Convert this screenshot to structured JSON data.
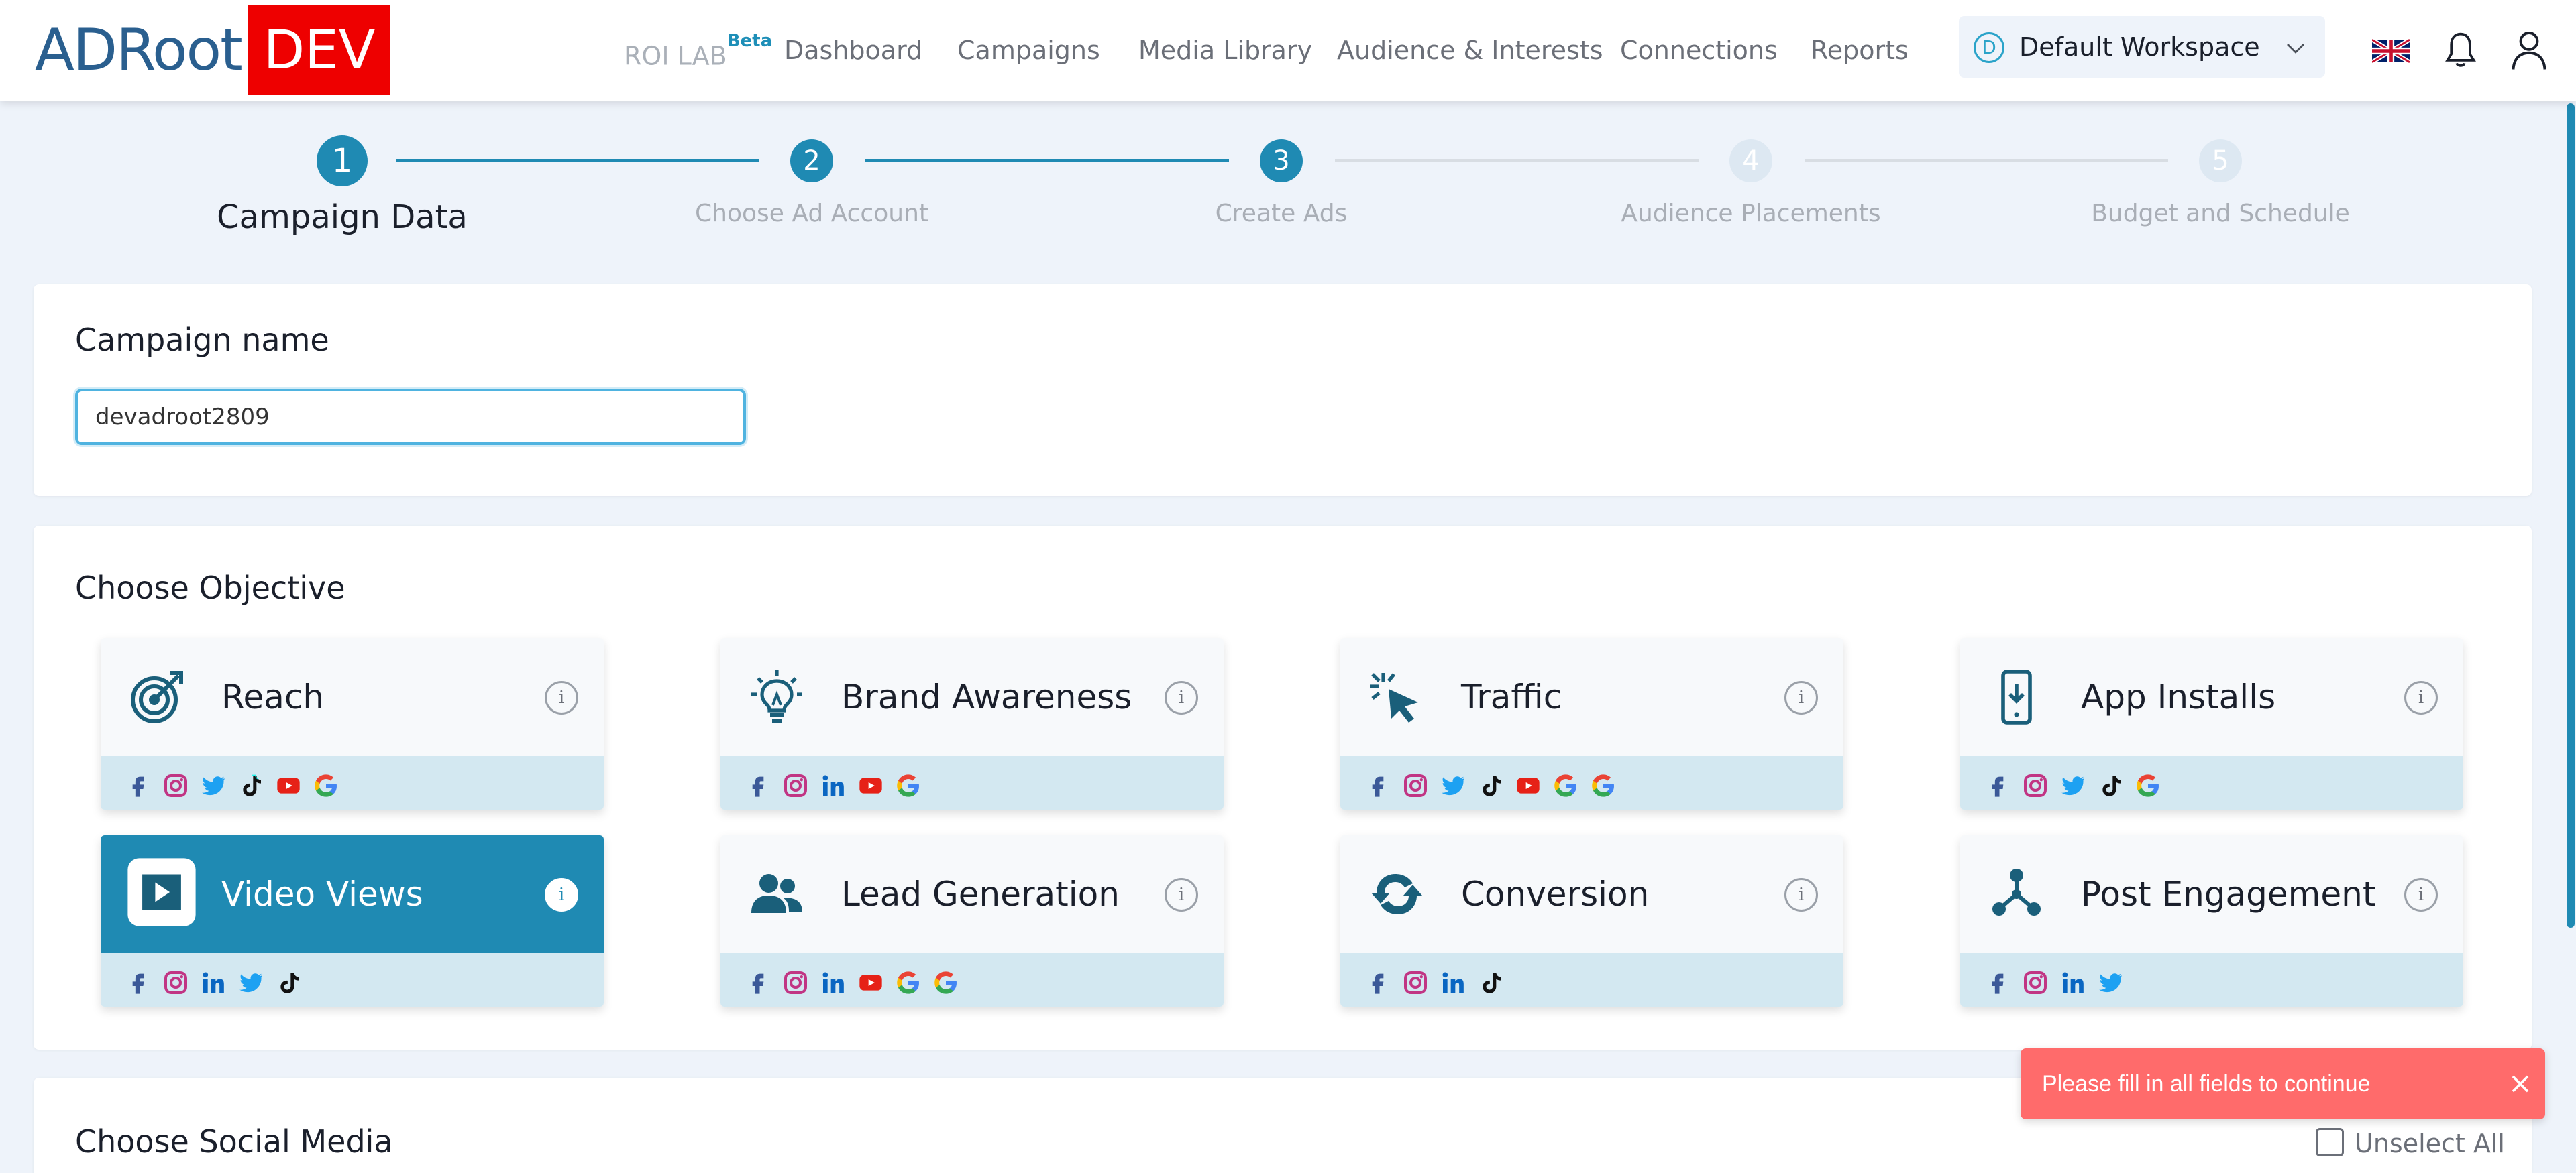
{
  "header": {
    "logo_text": "ADRoot",
    "env_badge": "DEV",
    "nav": {
      "roi_lab": "ROI LAB",
      "roi_beta": "Beta",
      "dashboard": "Dashboard",
      "campaigns": "Campaigns",
      "media_library": "Media Library",
      "audience": "Audience & Interests",
      "connections": "Connections",
      "reports": "Reports"
    },
    "workspace": {
      "initial": "D",
      "label": "Default Workspace"
    },
    "icons": [
      "uk-flag-icon",
      "bell-icon",
      "user-icon"
    ]
  },
  "stepper": {
    "current_step": 1,
    "steps": [
      {
        "number": "1",
        "label": "Campaign Data",
        "state": "active"
      },
      {
        "number": "2",
        "label": "Choose Ad Account",
        "state": "done"
      },
      {
        "number": "3",
        "label": "Create Ads",
        "state": "done"
      },
      {
        "number": "4",
        "label": "Audience Placements",
        "state": "pending"
      },
      {
        "number": "5",
        "label": "Budget and Schedule",
        "state": "pending"
      }
    ]
  },
  "campaign_name": {
    "title": "Campaign name",
    "value": "devadroot2809"
  },
  "objective": {
    "title": "Choose Objective",
    "info_glyph": "i",
    "selected": "Video Views",
    "items": [
      {
        "label": "Reach",
        "icon": "target-icon",
        "platforms": [
          "facebook",
          "instagram",
          "twitter",
          "tiktok",
          "youtube",
          "google"
        ]
      },
      {
        "label": "Brand Awareness",
        "icon": "lightbulb-icon",
        "platforms": [
          "facebook",
          "instagram",
          "linkedin",
          "youtube",
          "google"
        ]
      },
      {
        "label": "Traffic",
        "icon": "cursor-click-icon",
        "platforms": [
          "facebook",
          "instagram",
          "twitter",
          "tiktok",
          "youtube",
          "google",
          "google"
        ]
      },
      {
        "label": "App Installs",
        "icon": "phone-download-icon",
        "platforms": [
          "facebook",
          "instagram",
          "twitter",
          "tiktok",
          "google"
        ]
      },
      {
        "label": "Video Views",
        "icon": "play-icon",
        "platforms": [
          "facebook",
          "instagram",
          "linkedin",
          "twitter",
          "tiktok"
        ]
      },
      {
        "label": "Lead Generation",
        "icon": "users-icon",
        "platforms": [
          "facebook",
          "instagram",
          "linkedin",
          "youtube",
          "google",
          "google"
        ]
      },
      {
        "label": "Conversion",
        "icon": "sync-icon",
        "platforms": [
          "facebook",
          "instagram",
          "linkedin",
          "tiktok"
        ]
      },
      {
        "label": "Post Engagement",
        "icon": "network-icon",
        "platforms": [
          "facebook",
          "instagram",
          "linkedin",
          "twitter"
        ]
      }
    ]
  },
  "social_media": {
    "title": "Choose Social Media",
    "unselect_all": "Unselect All",
    "unselect_checked": false
  },
  "toast": {
    "message": "Please fill in all fields to continue",
    "type": "error"
  },
  "colors": {
    "accent": "#1f8ab3",
    "dev_badge": "#ee0000",
    "toast_bg": "#ff6b6b",
    "platform_strip": "#d3e8f1",
    "page_bg": "#eef3fa"
  }
}
